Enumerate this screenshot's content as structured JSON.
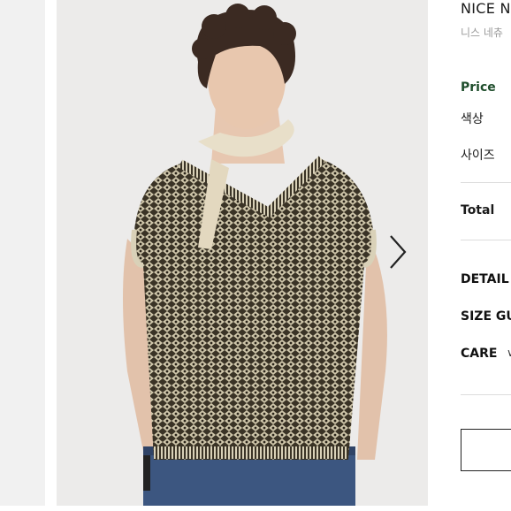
{
  "product": {
    "name": "NICE N",
    "subtitle": "니스 네츄"
  },
  "options": {
    "price_label": "Price",
    "color_label": "색상",
    "size_label": "사이즈",
    "total_label": "Total"
  },
  "sections": {
    "detail": "DETAIL",
    "size_guide": "SIZE GU",
    "care": "CARE",
    "care_chevron": "∨"
  },
  "gallery": {
    "next_icon": "chevron-right-icon"
  },
  "colors": {
    "price_accent": "#1e4d2b",
    "text": "#1a1a1a",
    "muted": "#9a9a9a"
  }
}
